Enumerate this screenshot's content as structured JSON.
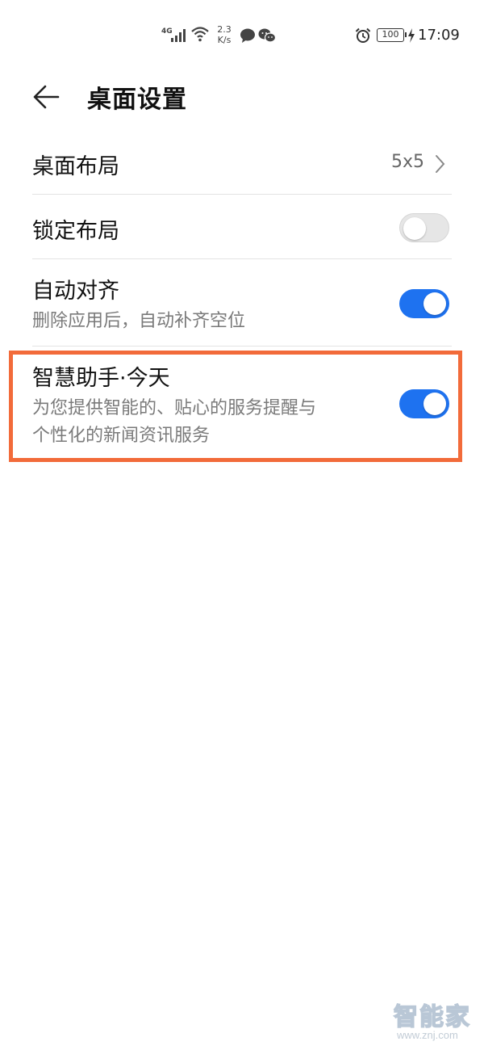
{
  "status_bar": {
    "network": "4G",
    "speed_value": "2.3",
    "speed_unit": "K/s",
    "battery": "100",
    "time": "17:09"
  },
  "header": {
    "title": "桌面设置"
  },
  "settings": {
    "layout": {
      "label": "桌面布局",
      "value": "5x5"
    },
    "lock_layout": {
      "label": "锁定布局",
      "enabled": false
    },
    "auto_align": {
      "label": "自动对齐",
      "description": "删除应用后，自动补齐空位",
      "enabled": true
    },
    "smart_assistant": {
      "label": "智慧助手·今天",
      "description_line1": "为您提供智能的、贴心的服务提醒与",
      "description_line2": "个性化的新闻资讯服务",
      "enabled": true
    }
  },
  "colors": {
    "toggle_on": "#1e72f0",
    "toggle_off": "#e6e6e6",
    "highlight": "#f26b3a"
  },
  "watermark": {
    "brand": "智能家",
    "url": "www.znj.com"
  }
}
